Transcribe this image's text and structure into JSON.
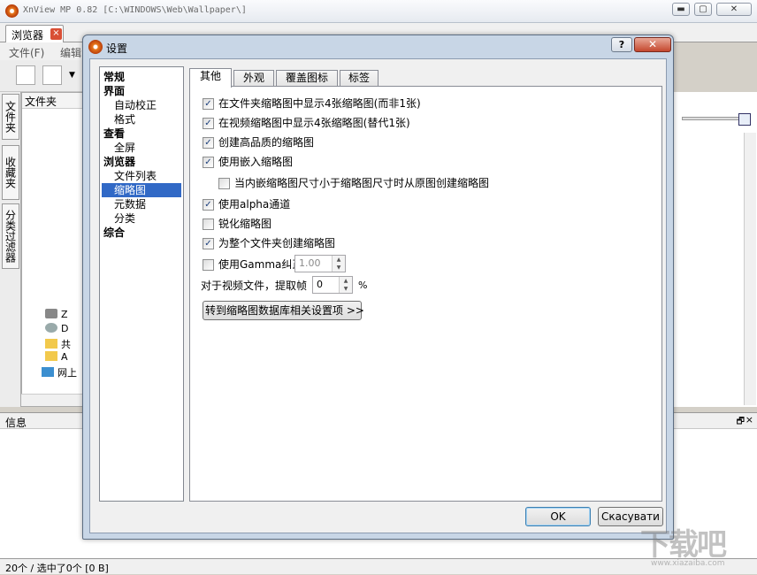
{
  "app": {
    "title": "XnView MP 0.82 [C:\\WINDOWS\\Web\\Wallpaper\\]",
    "tab_label": "浏览器",
    "menu_file": "文件(F)",
    "menu_edit": "编辑",
    "side_tab_folders": "文件夹",
    "side_tab_favorites": "收藏夹",
    "side_tab_filter": "分类过滤器",
    "folder_header": "文件夹",
    "tree_items": [
      "Z",
      "D",
      "共",
      "A",
      "网上"
    ],
    "info_header": "信息",
    "status": "20个 / 选中了0个 [0 B]"
  },
  "dialog": {
    "title": "设置",
    "help_label": "?",
    "close_label": "✕",
    "categories": [
      {
        "label": "常规",
        "level": "top"
      },
      {
        "label": "界面",
        "level": "top"
      },
      {
        "label": "自动校正",
        "level": "sub"
      },
      {
        "label": "格式",
        "level": "sub"
      },
      {
        "label": "查看",
        "level": "top"
      },
      {
        "label": "全屏",
        "level": "sub"
      },
      {
        "label": "浏览器",
        "level": "top"
      },
      {
        "label": "文件列表",
        "level": "sub"
      },
      {
        "label": "缩略图",
        "level": "sub",
        "selected": true
      },
      {
        "label": "元数据",
        "level": "sub"
      },
      {
        "label": "分类",
        "level": "sub"
      },
      {
        "label": "综合",
        "level": "top"
      }
    ],
    "tabs": [
      "其他",
      "外观",
      "覆盖图标",
      "标签"
    ],
    "active_tab": "其他",
    "options": [
      {
        "label": "在文件夹缩略图中显示4张缩略图(而非1张)",
        "checked": true
      },
      {
        "label": "在视频缩略图中显示4张缩略图(替代1张)",
        "checked": true
      },
      {
        "label": "创建高品质的缩略图",
        "checked": true
      },
      {
        "label": "使用嵌入缩略图",
        "checked": true
      },
      {
        "label": "当内嵌缩略图尺寸小于缩略图尺寸时从原图创建缩略图",
        "checked": false
      },
      {
        "label": "使用alpha通道",
        "checked": true
      },
      {
        "label": "锐化缩略图",
        "checked": false
      },
      {
        "label": "为整个文件夹创建缩略图",
        "checked": true
      },
      {
        "label": "使用Gamma纠正",
        "checked": false
      }
    ],
    "gamma_value": "1.00",
    "video_frame_label": "对于视频文件，提取帧",
    "video_frame_value": "0",
    "video_frame_unit": "%",
    "db_button_label": "转到缩略图数据库相关设置项 >>",
    "ok_label": "OK",
    "cancel_label": "Скасувати"
  },
  "watermark": {
    "main": "下载吧",
    "sub": "www.xiazaiba.com"
  }
}
